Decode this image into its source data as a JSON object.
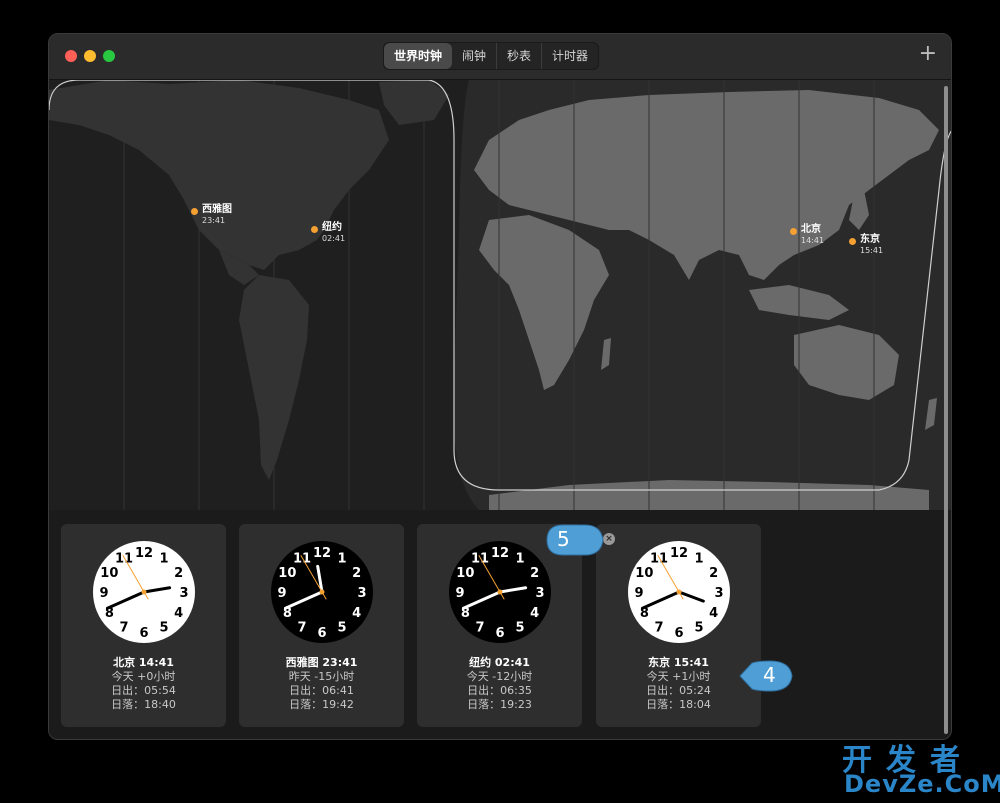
{
  "window": {
    "tabs": [
      {
        "label": "世界时钟",
        "active": true
      },
      {
        "label": "闹钟",
        "active": false
      },
      {
        "label": "秒表",
        "active": false
      },
      {
        "label": "计时器",
        "active": false
      }
    ],
    "add_label": "+"
  },
  "map": {
    "markers": [
      {
        "name": "西雅图",
        "time": "23:41"
      },
      {
        "name": "纽约",
        "time": "02:41"
      },
      {
        "name": "北京",
        "time": "14:41"
      },
      {
        "name": "东京",
        "time": "15:41"
      }
    ]
  },
  "clocks": [
    {
      "city_time": "北京 14:41",
      "offset": "今天 +0小时",
      "sunrise": "日出：05:54",
      "sunset": "日落：18:40",
      "face": "light",
      "hour": 14,
      "minute": 41,
      "second": 55
    },
    {
      "city_time": "西雅图 23:41",
      "offset": "昨天 -15小时",
      "sunrise": "日出：06:41",
      "sunset": "日落：19:42",
      "face": "dark",
      "hour": 23,
      "minute": 41,
      "second": 55
    },
    {
      "city_time": "纽约 02:41",
      "offset": "今天 -12小时",
      "sunrise": "日出：06:35",
      "sunset": "日落：19:23",
      "face": "dark",
      "hour": 2,
      "minute": 41,
      "second": 55
    },
    {
      "city_time": "东京 15:41",
      "offset": "今天 +1小时",
      "sunrise": "日出：05:24",
      "sunset": "日落：18:04",
      "face": "light",
      "hour": 15,
      "minute": 41,
      "second": 55
    }
  ],
  "clock_numerals": [
    "12",
    "1",
    "2",
    "3",
    "4",
    "5",
    "6",
    "7",
    "8",
    "9",
    "10",
    "11"
  ],
  "remove_label": "×",
  "callouts": [
    "5",
    "4"
  ],
  "watermark": {
    "top": "开发者",
    "bottom": "DevZe.CoM"
  },
  "colors": {
    "marker": "#f5a033",
    "second_hand": "#f5a033",
    "callout": "#4f9fd6",
    "watermark": "#2a86c8"
  }
}
